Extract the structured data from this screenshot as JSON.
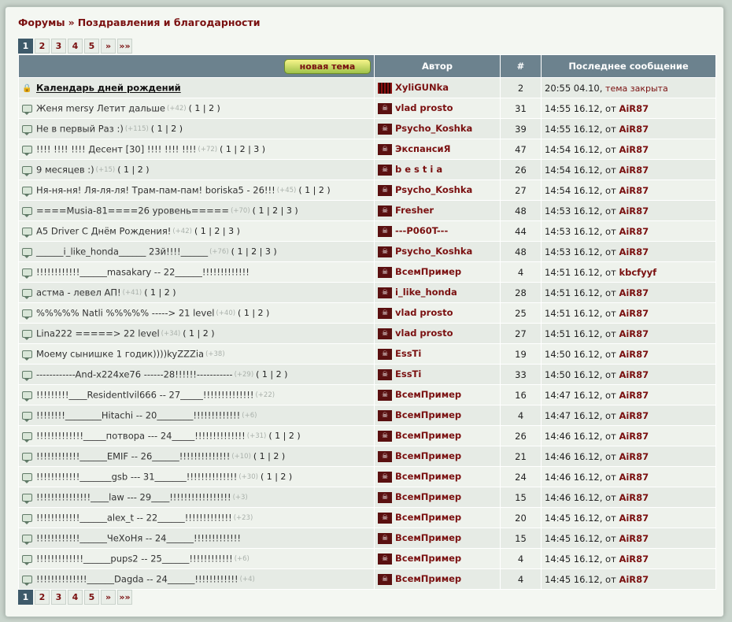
{
  "breadcrumb": {
    "root": "Форумы",
    "separator": "»",
    "current": "Поздравления и благодарности"
  },
  "pager": {
    "pages": [
      "1",
      "2",
      "3",
      "4",
      "5",
      "»",
      "»»"
    ],
    "active": "1"
  },
  "table": {
    "new_topic_button": "новая тема",
    "headers": {
      "author": "Автор",
      "replies": "#",
      "last": "Последнее сообщение"
    },
    "by_word": "от",
    "closed_text": "тема закрыта",
    "rows": [
      {
        "title": "Календарь дней рождений",
        "count": "",
        "pages": "",
        "author": "XyliGUNka",
        "replies": "2",
        "time": "20:55 04.10,",
        "by": "",
        "closed": true,
        "locked": true,
        "avatar": "bars"
      },
      {
        "title": "Женя mersy Летит дальше",
        "count": "(+42)",
        "pages": "( 1 | 2 )",
        "author": "vlad prosto",
        "replies": "31",
        "time": "14:55 16.12,",
        "by": "AiR87"
      },
      {
        "title": "Не в первый Раз :)",
        "count": "(+115)",
        "pages": "( 1 | 2 )",
        "author": "Psycho_Koshka",
        "replies": "39",
        "time": "14:55 16.12,",
        "by": "AiR87"
      },
      {
        "title": "!!!! !!!! !!!! Десент [30] !!!! !!!! !!!!",
        "count": "(+72)",
        "pages": "( 1 | 2 | 3 )",
        "author": "ЭкспансиЯ",
        "replies": "47",
        "time": "14:54 16.12,",
        "by": "AiR87"
      },
      {
        "title": "9 месяцев :)",
        "count": "(+15)",
        "pages": "( 1 | 2 )",
        "author": "b e s t i a",
        "replies": "26",
        "time": "14:54 16.12,",
        "by": "AiR87"
      },
      {
        "title": "Ня-ня-ня! Ля-ля-ля! Трам-пам-пам! boriska5 - 26!!!",
        "count": "(+45)",
        "pages": "( 1 | 2 )",
        "author": "Psycho_Koshka",
        "replies": "27",
        "time": "14:54 16.12,",
        "by": "AiR87"
      },
      {
        "title": "====Musia-81====26 уровень=====",
        "count": "(+70)",
        "pages": "( 1 | 2 | 3 )",
        "author": "Fresher",
        "replies": "48",
        "time": "14:53 16.12,",
        "by": "AiR87"
      },
      {
        "title": "A5 Driver С Днём Рождения!",
        "count": "(+42)",
        "pages": "( 1 | 2 | 3 )",
        "author": "---P060T---",
        "replies": "44",
        "time": "14:53 16.12,",
        "by": "AiR87"
      },
      {
        "title": "______i_like_honda______ 23й!!!!______",
        "count": "(+76)",
        "pages": "( 1 | 2 | 3 )",
        "author": "Psycho_Koshka",
        "replies": "48",
        "time": "14:53 16.12,",
        "by": "AiR87"
      },
      {
        "title": "!!!!!!!!!!!!______masakary -- 22______!!!!!!!!!!!!!",
        "count": "",
        "pages": "",
        "author": "ВсемПример",
        "replies": "4",
        "time": "14:51 16.12,",
        "by": "kbcfyyf"
      },
      {
        "title": "астма - левел АП!",
        "count": "(+41)",
        "pages": "( 1 | 2 )",
        "author": "i_like_honda",
        "replies": "28",
        "time": "14:51 16.12,",
        "by": "AiR87"
      },
      {
        "title": "%%%%% Natli %%%%% -----> 21 level",
        "count": "(+40)",
        "pages": "( 1 | 2 )",
        "author": "vlad prosto",
        "replies": "25",
        "time": "14:51 16.12,",
        "by": "AiR87"
      },
      {
        "title": "Lina222 =====> 22 level",
        "count": "(+34)",
        "pages": "( 1 | 2 )",
        "author": "vlad prosto",
        "replies": "27",
        "time": "14:51 16.12,",
        "by": "AiR87"
      },
      {
        "title": "Моему сынишке 1 годик))))kyZZZia",
        "count": "(+38)",
        "pages": "",
        "author": "EssTi",
        "replies": "19",
        "time": "14:50 16.12,",
        "by": "AiR87"
      },
      {
        "title": "------------And-x224xe76 ------28!!!!!!-----------",
        "count": "(+29)",
        "pages": "( 1 | 2 )",
        "author": "EssTi",
        "replies": "33",
        "time": "14:50 16.12,",
        "by": "AiR87"
      },
      {
        "title": "!!!!!!!!!____ResidentIvil666 -- 27_____!!!!!!!!!!!!!!",
        "count": "(+22)",
        "pages": "",
        "author": "ВсемПример",
        "replies": "16",
        "time": "14:47 16.12,",
        "by": "AiR87"
      },
      {
        "title": "!!!!!!!!________Hitachi -- 20________!!!!!!!!!!!!!",
        "count": "(+6)",
        "pages": "",
        "author": "ВсемПример",
        "replies": "4",
        "time": "14:47 16.12,",
        "by": "AiR87"
      },
      {
        "title": "!!!!!!!!!!!!!_____потвора --- 24_____!!!!!!!!!!!!!!",
        "count": "(+31)",
        "pages": "( 1 | 2 )",
        "author": "ВсемПример",
        "replies": "26",
        "time": "14:46 16.12,",
        "by": "AiR87"
      },
      {
        "title": "!!!!!!!!!!!!______EMIF -- 26______!!!!!!!!!!!!!!",
        "count": "(+10)",
        "pages": "( 1 | 2 )",
        "author": "ВсемПример",
        "replies": "21",
        "time": "14:46 16.12,",
        "by": "AiR87"
      },
      {
        "title": "!!!!!!!!!!!!_______gsb --- 31_______!!!!!!!!!!!!!!",
        "count": "(+30)",
        "pages": "( 1 | 2 )",
        "author": "ВсемПример",
        "replies": "24",
        "time": "14:46 16.12,",
        "by": "AiR87"
      },
      {
        "title": "!!!!!!!!!!!!!!!____law --- 29____!!!!!!!!!!!!!!!!!",
        "count": "(+3)",
        "pages": "",
        "author": "ВсемПример",
        "replies": "15",
        "time": "14:46 16.12,",
        "by": "AiR87"
      },
      {
        "title": "!!!!!!!!!!!!______alex_t -- 22______!!!!!!!!!!!!!",
        "count": "(+23)",
        "pages": "",
        "author": "ВсемПример",
        "replies": "20",
        "time": "14:45 16.12,",
        "by": "AiR87"
      },
      {
        "title": "!!!!!!!!!!!!______ЧеХоНя -- 24______!!!!!!!!!!!!!",
        "count": "",
        "pages": "",
        "author": "ВсемПример",
        "replies": "15",
        "time": "14:45 16.12,",
        "by": "AiR87"
      },
      {
        "title": "!!!!!!!!!!!!!______pups2 -- 25______!!!!!!!!!!!!",
        "count": "(+6)",
        "pages": "",
        "author": "ВсемПример",
        "replies": "4",
        "time": "14:45 16.12,",
        "by": "AiR87"
      },
      {
        "title": "!!!!!!!!!!!!!!______Dagda -- 24______!!!!!!!!!!!!",
        "count": "(+4)",
        "pages": "",
        "author": "ВсемПример",
        "replies": "4",
        "time": "14:45 16.12,",
        "by": "AiR87"
      }
    ]
  },
  "icons": {
    "topic": "speech-bubble-icon",
    "locked": "lock-icon",
    "avatar": "skull-avatar-icon"
  },
  "colors": {
    "header_bg": "#6c828e",
    "link": "#7a1010",
    "active_page": "#3e5a6a",
    "button": "#b8d65a"
  }
}
